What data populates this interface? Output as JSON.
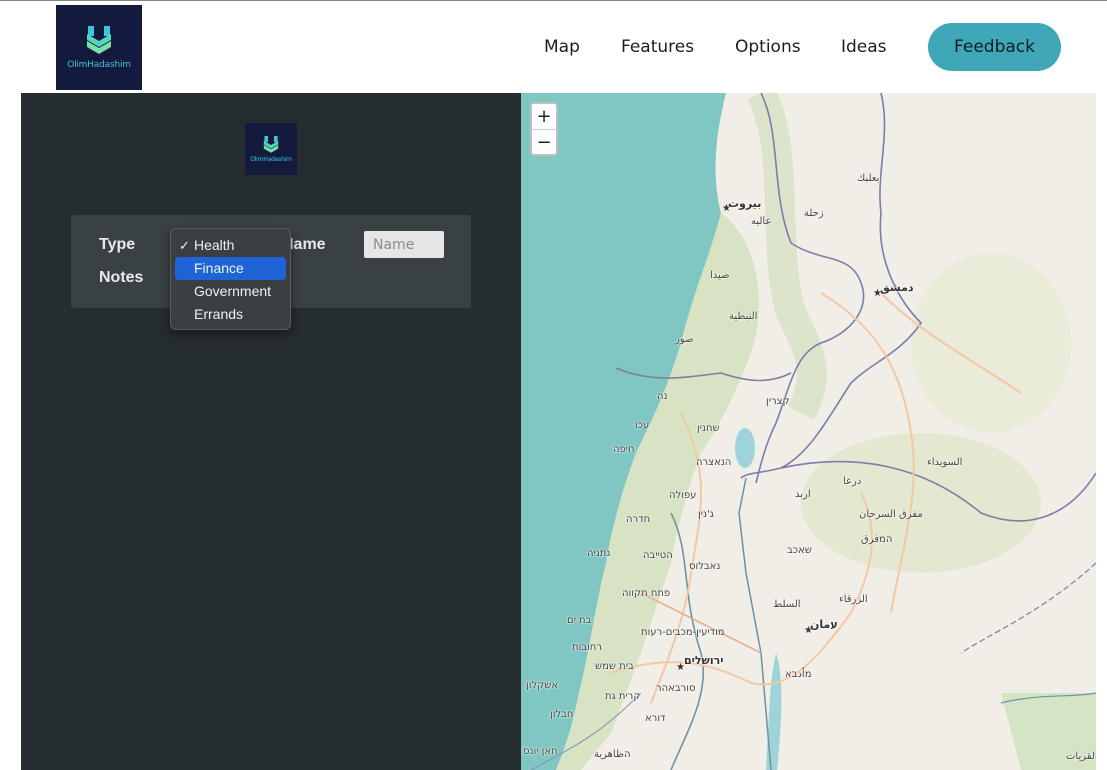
{
  "brand": {
    "logo_text": "OlimHadashim",
    "logo_bg": "#141a3d",
    "logo_accent": "#3fc4d9"
  },
  "nav": {
    "items": [
      {
        "label": "Map"
      },
      {
        "label": "Features"
      },
      {
        "label": "Options"
      },
      {
        "label": "Ideas"
      }
    ],
    "feedback_label": "Feedback",
    "feedback_color": "#40a7b8"
  },
  "form": {
    "type_label": "Type",
    "name_label": "Name",
    "name_placeholder": "Name",
    "notes_label": "Notes"
  },
  "dropdown": {
    "options": [
      {
        "label": "Health",
        "checked": true
      },
      {
        "label": "Finance",
        "highlighted": true
      },
      {
        "label": "Government"
      },
      {
        "label": "Errands"
      }
    ],
    "check_glyph": "✓"
  },
  "map": {
    "zoom_in": "+",
    "zoom_out": "−",
    "places": [
      {
        "name": "بيروت",
        "capital": true
      },
      {
        "name": "بعلبك"
      },
      {
        "name": "زحلة"
      },
      {
        "name": "عاليه"
      },
      {
        "name": "صيدا"
      },
      {
        "name": "النبطية"
      },
      {
        "name": "صور"
      },
      {
        "name": "دمشق",
        "capital": true
      },
      {
        "name": "קצרין"
      },
      {
        "name": "נה"
      },
      {
        "name": "עכו"
      },
      {
        "name": "שחנין"
      },
      {
        "name": "חיפה"
      },
      {
        "name": "הנאצרה"
      },
      {
        "name": "السويداء"
      },
      {
        "name": "درعا"
      },
      {
        "name": "עפולה"
      },
      {
        "name": "اربد"
      },
      {
        "name": "ג'נין"
      },
      {
        "name": "חדרה"
      },
      {
        "name": "مفرق السرحان"
      },
      {
        "name": "המفرق"
      },
      {
        "name": "נתניה"
      },
      {
        "name": "הטייבה"
      },
      {
        "name": "שאכב"
      },
      {
        "name": "נאבלוס"
      },
      {
        "name": "פתח תקווה"
      },
      {
        "name": "الزرقاء"
      },
      {
        "name": "السلط"
      },
      {
        "name": "בת ים"
      },
      {
        "name": "מודיעין-מכבים-רעות"
      },
      {
        "name": "עمان",
        "capital": true
      },
      {
        "name": "רחובות"
      },
      {
        "name": "ירושלים",
        "capital": true
      },
      {
        "name": "בית שמש"
      },
      {
        "name": "מأدבא"
      },
      {
        "name": "אשקלון"
      },
      {
        "name": "סורבאהר"
      },
      {
        "name": "קרית גת"
      },
      {
        "name": "חבלון"
      },
      {
        "name": "דורא"
      },
      {
        "name": "הظاهرية"
      },
      {
        "name": "חאן יונס"
      },
      {
        "name": "القريات"
      }
    ]
  }
}
